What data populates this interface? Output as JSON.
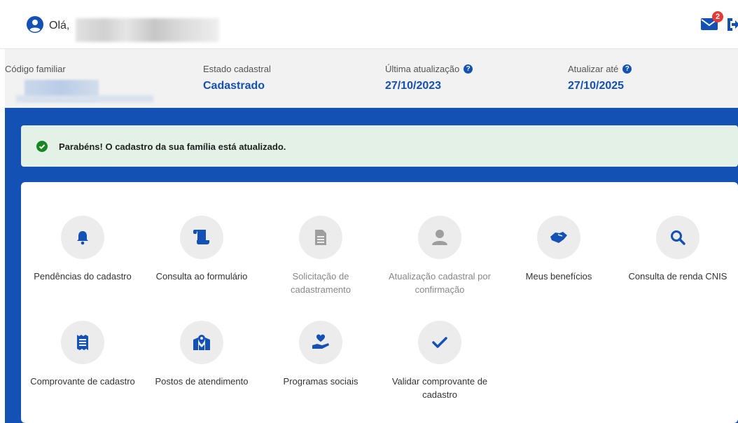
{
  "header": {
    "greeting": "Olá,",
    "mail_badge_count": "2"
  },
  "info": {
    "codigo_label": "Código familiar",
    "estado_label": "Estado cadastral",
    "estado_value": "Cadastrado",
    "ultima_label": "Última atualização",
    "ultima_value": "27/10/2023",
    "atualizar_label": "Atualizar até",
    "atualizar_value": "27/10/2025"
  },
  "alert": {
    "message": "Parabéns! O cadastro da sua família está atualizado."
  },
  "tiles": [
    {
      "label": "Pendências do cadastro",
      "icon": "bell-icon"
    },
    {
      "label": "Consulta ao formulário",
      "icon": "scroll-icon"
    },
    {
      "label": "Solicitação de cadastramento",
      "icon": "document-icon"
    },
    {
      "label": "Atualização cadastral por confirmação",
      "icon": "user-icon"
    },
    {
      "label": "Meus benefícios",
      "icon": "handshake-icon"
    },
    {
      "label": "Consulta de renda CNIS",
      "icon": "search-icon"
    },
    {
      "label": "Comprovante de cadastro",
      "icon": "receipt-icon"
    },
    {
      "label": "Postos de atendimento",
      "icon": "map-icon"
    },
    {
      "label": "Programas sociais",
      "icon": "hand-heart-icon"
    },
    {
      "label": "Validar comprovante de cadastro",
      "icon": "check-icon"
    }
  ],
  "colors": {
    "primary": "#1351b4",
    "success_bg": "#e3f1e6",
    "success": "#168821",
    "disabled_icon": "#9e9e9e",
    "badge": "#e53935"
  }
}
